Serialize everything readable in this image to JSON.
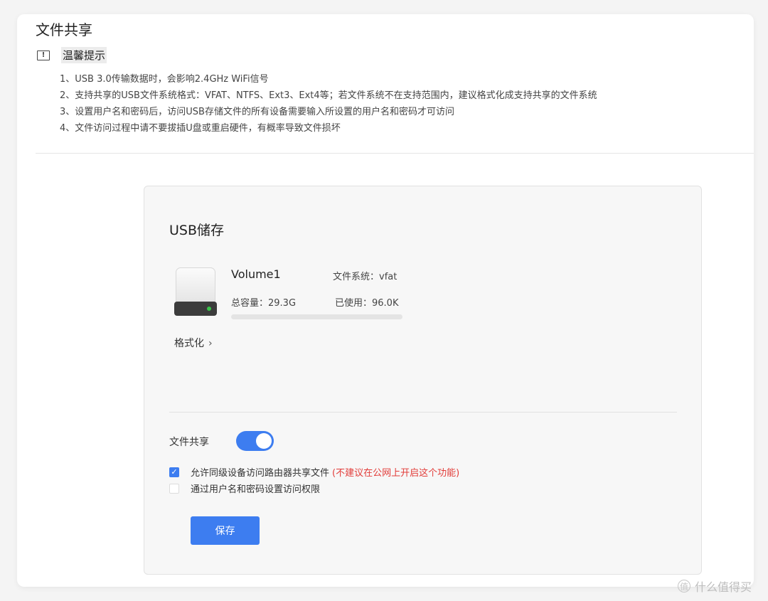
{
  "page": {
    "title": "文件共享",
    "tips_title": "温馨提示",
    "tips": [
      "1、USB 3.0传输数据时，会影响2.4GHz WiFi信号",
      "2、支持共享的USB文件系统格式：VFAT、NTFS、Ext3、Ext4等；若文件系统不在支持范围内，建议格式化成支持共享的文件系统",
      "3、设置用户名和密码后，访问USB存储文件的所有设备需要输入所设置的用户名和密码才可访问",
      "4、文件访问过程中请不要拔插U盘或重启硬件，有概率导致文件损坏"
    ]
  },
  "usb": {
    "section_title": "USB储存",
    "volume_name": "Volume1",
    "filesystem": "文件系统：vfat",
    "capacity": "总容量：29.3G",
    "used": "已使用：96.0K",
    "usage_fraction": 0.0,
    "format_link": "格式化",
    "format_chevron": "›"
  },
  "share": {
    "label": "文件共享",
    "enabled": true,
    "allow_peers_label": "允许同级设备访问路由器共享文件",
    "allow_peers_warning": "(不建议在公网上开启这个功能)",
    "allow_peers_checked": true,
    "auth_label": "通过用户名和密码设置访问权限",
    "auth_checked": false,
    "save_label": "保存"
  },
  "watermark": {
    "text": "什么值得买",
    "icon": "值"
  },
  "colors": {
    "accent": "#3d7df0",
    "warning": "#e23c39",
    "led": "#3ac44a"
  }
}
